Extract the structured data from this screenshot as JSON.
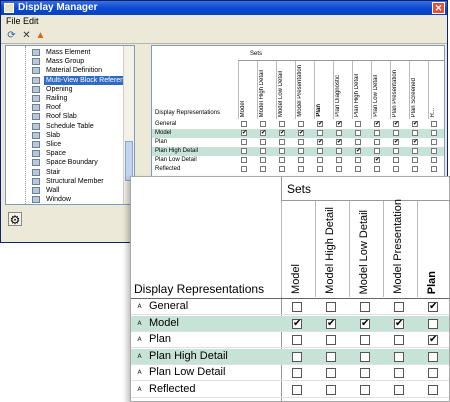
{
  "window": {
    "title": "Display Manager",
    "close_glyph": "✕"
  },
  "menu": [
    {
      "label": "File"
    },
    {
      "label": "Edit"
    }
  ],
  "toolbar": [
    {
      "icon": "purge-icon",
      "glyph": "⟳"
    },
    {
      "icon": "delete-icon",
      "glyph": "✕"
    },
    {
      "icon": "fire-icon",
      "glyph": "▲"
    }
  ],
  "tree": {
    "items": [
      {
        "label": "Mass Element"
      },
      {
        "label": "Mass Group"
      },
      {
        "label": "Material Definition"
      },
      {
        "label": "Multi-View Block Reference",
        "selected": true
      },
      {
        "label": "Opening"
      },
      {
        "label": "Railing"
      },
      {
        "label": "Roof"
      },
      {
        "label": "Roof Slab"
      },
      {
        "label": "Schedule Table"
      },
      {
        "label": "Slab"
      },
      {
        "label": "Slice"
      },
      {
        "label": "Space"
      },
      {
        "label": "Space Boundary"
      },
      {
        "label": "Stair"
      },
      {
        "label": "Structural Member"
      },
      {
        "label": "Wall"
      },
      {
        "label": "Window"
      }
    ]
  },
  "bottom_icon": {
    "icon": "display-manager-icon",
    "glyph": "⚙"
  },
  "small_table": {
    "sets_label": "Sets",
    "display_representations_label": "Display Representations",
    "columns": [
      {
        "label": "Model",
        "bold": false
      },
      {
        "label": "Model High Detail",
        "bold": false
      },
      {
        "label": "Model Low Detail",
        "bold": false
      },
      {
        "label": "Model Presentation",
        "bold": false
      },
      {
        "label": "Plan",
        "bold": true
      },
      {
        "label": "Plan Diagnostic",
        "bold": false
      },
      {
        "label": "Plan High Detail",
        "bold": false
      },
      {
        "label": "Plan Low Detail",
        "bold": false
      },
      {
        "label": "Plan Presentation",
        "bold": false
      },
      {
        "label": "Plan Screened",
        "bold": false
      },
      {
        "label": "R...",
        "bold": false
      }
    ],
    "rows": [
      {
        "label": "General",
        "highlight": false,
        "checks": [
          false,
          false,
          false,
          false,
          true,
          true,
          false,
          true,
          true,
          true,
          false
        ]
      },
      {
        "label": "Model",
        "highlight": true,
        "checks": [
          true,
          true,
          true,
          true,
          false,
          false,
          false,
          false,
          false,
          false,
          false
        ]
      },
      {
        "label": "Plan",
        "highlight": false,
        "checks": [
          false,
          false,
          false,
          false,
          true,
          true,
          false,
          false,
          true,
          true,
          false
        ]
      },
      {
        "label": "Plan High Detail",
        "highlight": true,
        "checks": [
          false,
          false,
          false,
          false,
          false,
          false,
          true,
          false,
          false,
          false,
          false
        ]
      },
      {
        "label": "Plan Low Detail",
        "highlight": false,
        "checks": [
          false,
          false,
          false,
          false,
          false,
          false,
          false,
          true,
          false,
          false,
          false
        ]
      },
      {
        "label": "Reflected",
        "highlight": false,
        "checks": [
          false,
          false,
          false,
          false,
          false,
          false,
          false,
          false,
          false,
          false,
          false
        ]
      }
    ]
  },
  "zoom_table": {
    "sets_label": "Sets",
    "display_representations_label": "Display Representations",
    "columns": [
      {
        "label": "Model",
        "bold": false
      },
      {
        "label": "Model High Detail",
        "bold": false
      },
      {
        "label": "Model Low Detail",
        "bold": false
      },
      {
        "label": "Model Presentation",
        "bold": false
      },
      {
        "label": "Plan",
        "bold": true
      }
    ],
    "rows": [
      {
        "label": "General",
        "icon": "general-rep-icon",
        "glyph": "ᴬ",
        "highlight": false,
        "checks": [
          false,
          false,
          false,
          false,
          true
        ]
      },
      {
        "label": "Model",
        "icon": "model-rep-icon",
        "glyph": "ᴬ",
        "highlight": true,
        "checks": [
          true,
          true,
          true,
          true,
          false
        ]
      },
      {
        "label": "Plan",
        "icon": "plan-rep-icon",
        "glyph": "ᴬ",
        "highlight": false,
        "checks": [
          false,
          false,
          false,
          false,
          true
        ]
      },
      {
        "label": "Plan High Detail",
        "icon": "plan-high-detail-rep-icon",
        "glyph": "ᴬ",
        "highlight": true,
        "checks": [
          false,
          false,
          false,
          false,
          false
        ]
      },
      {
        "label": "Plan Low Detail",
        "icon": "plan-low-detail-rep-icon",
        "glyph": "ᴬ",
        "highlight": false,
        "checks": [
          false,
          false,
          false,
          false,
          false
        ]
      },
      {
        "label": "Reflected",
        "icon": "reflected-rep-icon",
        "glyph": "ᴬ",
        "highlight": false,
        "checks": [
          false,
          false,
          false,
          false,
          false
        ]
      }
    ],
    "check_glyph": "✔"
  }
}
